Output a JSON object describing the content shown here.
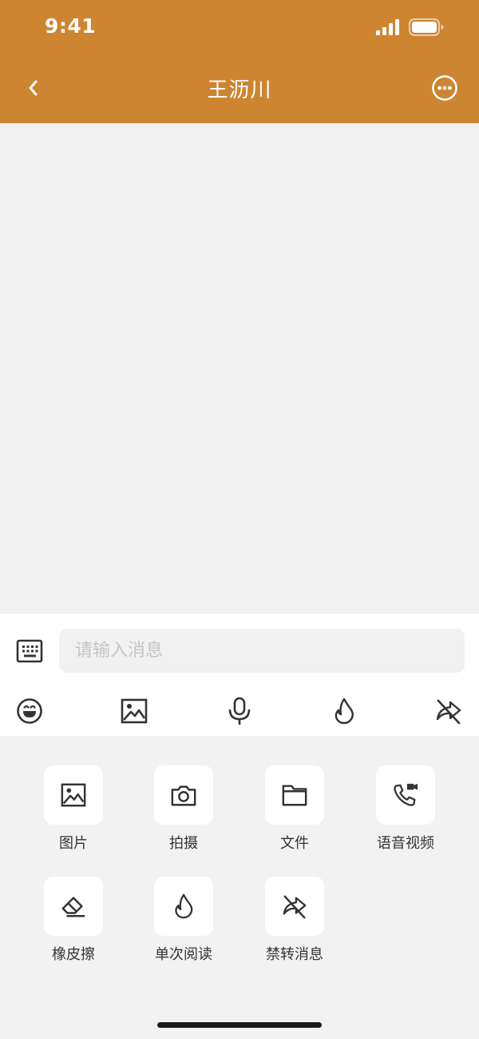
{
  "status_bar": {
    "time": "9:41"
  },
  "header": {
    "title": "王沥川",
    "background": "#cd8531"
  },
  "composer": {
    "placeholder": "请输入消息"
  },
  "toolbar": {
    "icons": [
      "emoji-icon",
      "image-icon",
      "microphone-icon",
      "flame-icon",
      "no-forward-icon"
    ]
  },
  "panel": {
    "items": [
      {
        "label": "图片",
        "icon": "image-icon"
      },
      {
        "label": "拍摄",
        "icon": "camera-icon"
      },
      {
        "label": "文件",
        "icon": "folder-icon"
      },
      {
        "label": "语音视频",
        "icon": "phone-video-icon"
      },
      {
        "label": "橡皮擦",
        "icon": "eraser-icon"
      },
      {
        "label": "单次阅读",
        "icon": "flame-icon"
      },
      {
        "label": "禁转消息",
        "icon": "no-forward-icon"
      }
    ]
  }
}
